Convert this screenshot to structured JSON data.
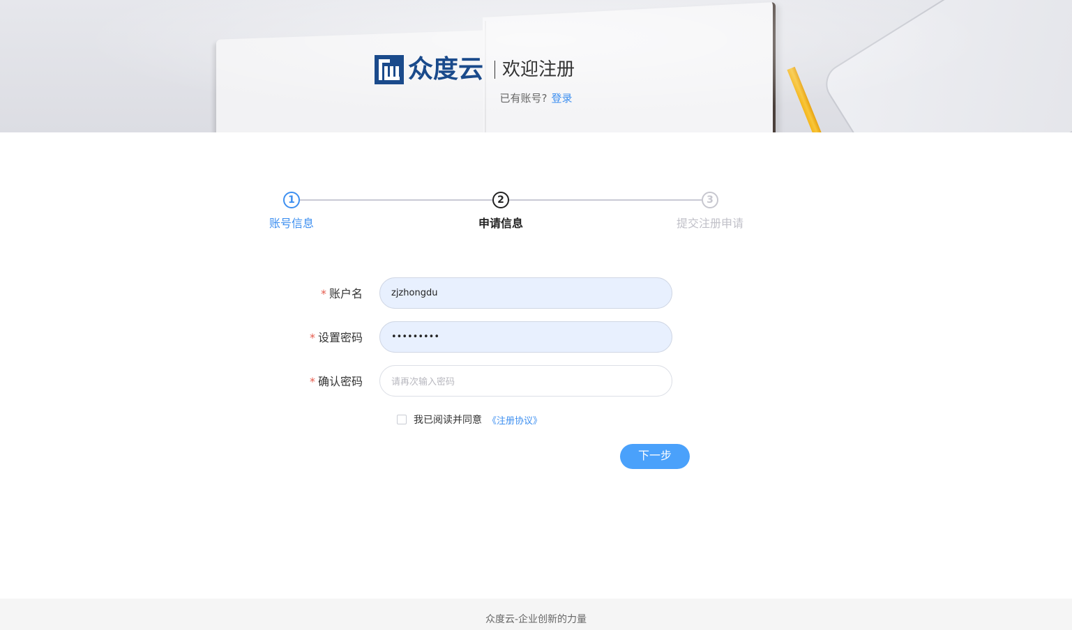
{
  "header": {
    "brand_name": "众度云",
    "welcome": "欢迎注册",
    "login_prompt": "已有账号?",
    "login_link": "登录"
  },
  "steps": [
    {
      "number": "1",
      "label": "账号信息",
      "state": "done"
    },
    {
      "number": "2",
      "label": "申请信息",
      "state": "active"
    },
    {
      "number": "3",
      "label": "提交注册申请",
      "state": "pending"
    }
  ],
  "form": {
    "account": {
      "required_mark": "*",
      "label": "账户名",
      "value": "zjzhongdu"
    },
    "password": {
      "required_mark": "*",
      "label": "设置密码",
      "value": "•••••••••"
    },
    "confirm": {
      "required_mark": "*",
      "label": "确认密码",
      "placeholder": "请再次输入密码"
    },
    "agree_text": "我已阅读并同意",
    "agreement_link": "《注册协议》",
    "next_button": "下一步"
  },
  "footer": {
    "text": "众度云-企业创新的力量"
  },
  "colors": {
    "brand": "#1a4a8b",
    "accent": "#3d8ff0",
    "button": "#4aa1fb",
    "required": "#e55b4d"
  }
}
